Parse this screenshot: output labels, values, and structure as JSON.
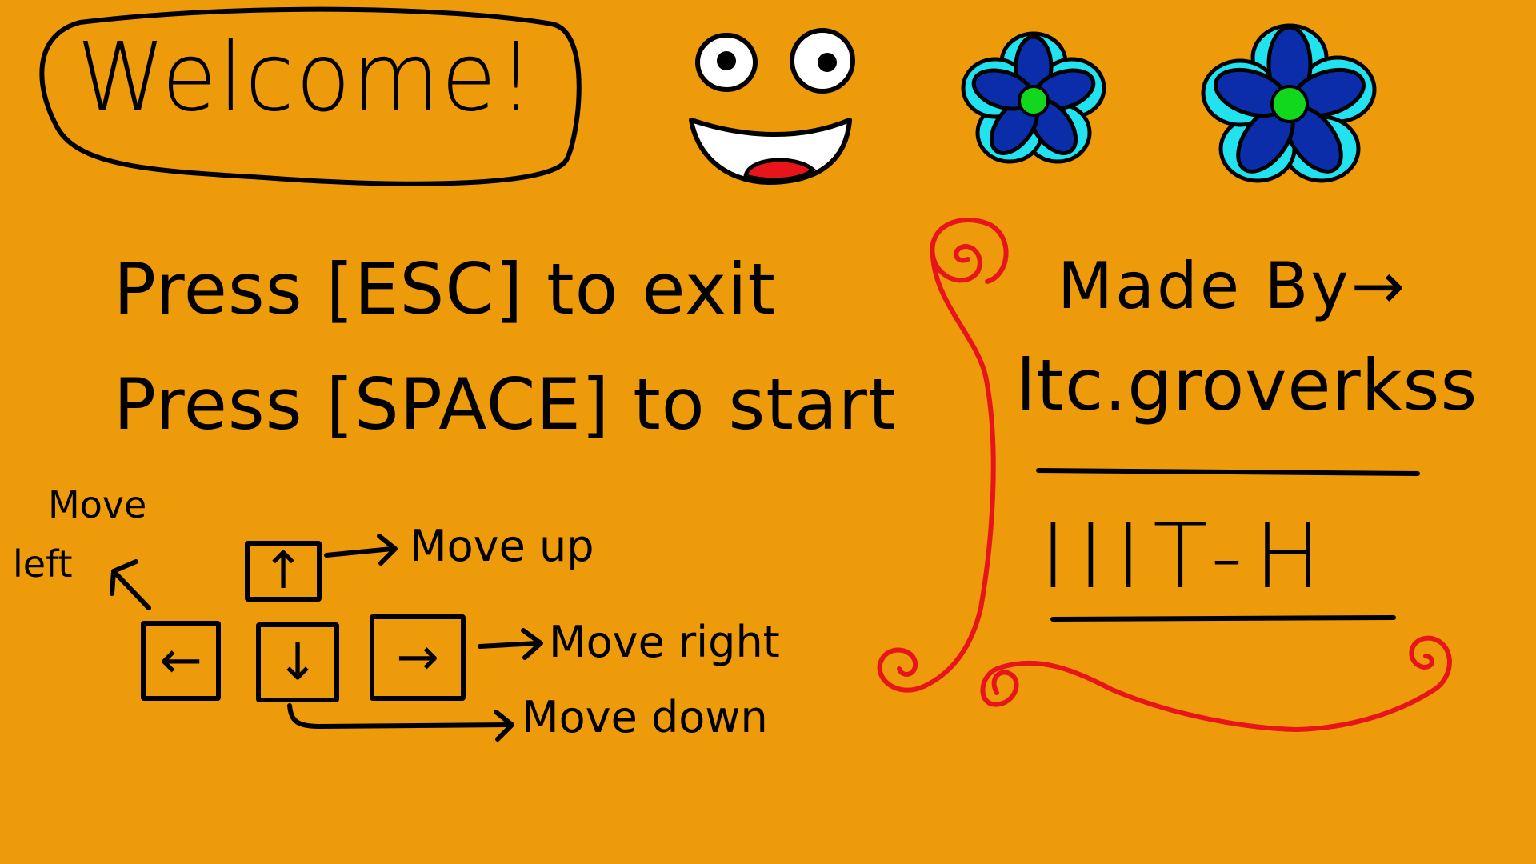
{
  "title": {
    "text": "Welcome!"
  },
  "instructions": {
    "exit": "Press [ESC] to exit",
    "start": "Press [SPACE] to start"
  },
  "controls": {
    "left_label_line1": "Move",
    "left_label_line2": "left",
    "up_label": "Move up",
    "right_label": "Move right",
    "down_label": "Move down",
    "key_up_glyph": "↑",
    "key_left_glyph": "←",
    "key_down_glyph": "↓",
    "key_right_glyph": "→"
  },
  "credits": {
    "made_by": "Made By→",
    "author": "ltc.groverkss",
    "institution": "IIIT-H"
  },
  "decor": {
    "icons": [
      "smiley-face-icon",
      "flower-icon",
      "flower-icon",
      "red-swirl-border-icon"
    ]
  },
  "colors": {
    "background": "#ED9A0B",
    "ink": "#000000",
    "swirl": "#E8141B",
    "petal_dark": "#0B2DAA",
    "petal_light": "#21E2EE",
    "flower_center": "#11D81C",
    "mouth_tongue": "#E8141B"
  }
}
